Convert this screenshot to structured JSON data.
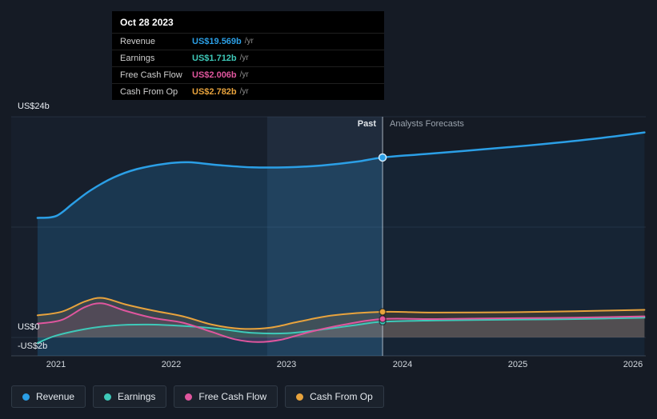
{
  "tooltip": {
    "date": "Oct 28 2023",
    "rows": [
      {
        "label": "Revenue",
        "value": "US$19.569b",
        "suffix": "/yr",
        "color": "#2b9fe6"
      },
      {
        "label": "Earnings",
        "value": "US$1.712b",
        "suffix": "/yr",
        "color": "#3ec9b9"
      },
      {
        "label": "Free Cash Flow",
        "value": "US$2.006b",
        "suffix": "/yr",
        "color": "#e0569e"
      },
      {
        "label": "Cash From Op",
        "value": "US$2.782b",
        "suffix": "/yr",
        "color": "#e8a33d"
      }
    ]
  },
  "annotations": {
    "past": "Past",
    "forecast": "Analysts Forecasts"
  },
  "axis": {
    "y_labels": [
      "US$24b",
      "US$0",
      "-US$2b"
    ],
    "x_labels": [
      "2021",
      "2022",
      "2023",
      "2024",
      "2025",
      "2026"
    ]
  },
  "legend": [
    {
      "label": "Revenue",
      "color": "#2b9fe6"
    },
    {
      "label": "Earnings",
      "color": "#3ec9b9"
    },
    {
      "label": "Free Cash Flow",
      "color": "#e0569e"
    },
    {
      "label": "Cash From Op",
      "color": "#e8a33d"
    }
  ],
  "chart_data": {
    "type": "area",
    "x_unit": "year",
    "xlim": [
      2020.6,
      2026.11
    ],
    "ylim": [
      -2,
      24
    ],
    "y_gridlines": [
      24,
      12,
      0
    ],
    "x_ticks": [
      2021,
      2022,
      2023,
      2024,
      2025,
      2026
    ],
    "divider_x": 2023.83,
    "hover_band": [
      2022.83,
      2023.83
    ],
    "legend_position": "bottom",
    "series": [
      {
        "name": "Revenue",
        "color": "#2b9fe6",
        "points": [
          [
            2020.84,
            13.0
          ],
          [
            2021.0,
            13.2
          ],
          [
            2021.15,
            14.6
          ],
          [
            2021.3,
            16.0
          ],
          [
            2021.5,
            17.4
          ],
          [
            2021.7,
            18.3
          ],
          [
            2021.95,
            18.9
          ],
          [
            2022.15,
            19.05
          ],
          [
            2022.4,
            18.75
          ],
          [
            2022.7,
            18.5
          ],
          [
            2023.0,
            18.5
          ],
          [
            2023.3,
            18.7
          ],
          [
            2023.6,
            19.1
          ],
          [
            2023.83,
            19.569
          ],
          [
            2024.2,
            19.95
          ],
          [
            2024.7,
            20.45
          ],
          [
            2025.2,
            21.0
          ],
          [
            2025.7,
            21.65
          ],
          [
            2026.1,
            22.3
          ]
        ]
      },
      {
        "name": "Earnings",
        "color": "#3ec9b9",
        "points": [
          [
            2020.84,
            -0.6
          ],
          [
            2021.0,
            0.2
          ],
          [
            2021.25,
            0.9
          ],
          [
            2021.5,
            1.3
          ],
          [
            2021.8,
            1.4
          ],
          [
            2022.1,
            1.25
          ],
          [
            2022.4,
            0.95
          ],
          [
            2022.7,
            0.5
          ],
          [
            2023.0,
            0.45
          ],
          [
            2023.3,
            0.85
          ],
          [
            2023.6,
            1.35
          ],
          [
            2023.83,
            1.712
          ],
          [
            2024.3,
            1.85
          ],
          [
            2025.0,
            1.95
          ],
          [
            2025.5,
            2.0
          ],
          [
            2026.1,
            2.15
          ]
        ]
      },
      {
        "name": "Free Cash Flow",
        "color": "#e0569e",
        "points": [
          [
            2020.84,
            1.5
          ],
          [
            2021.05,
            1.9
          ],
          [
            2021.25,
            3.3
          ],
          [
            2021.4,
            3.7
          ],
          [
            2021.6,
            2.9
          ],
          [
            2021.85,
            2.1
          ],
          [
            2022.1,
            1.6
          ],
          [
            2022.35,
            0.6
          ],
          [
            2022.55,
            -0.2
          ],
          [
            2022.75,
            -0.5
          ],
          [
            2022.95,
            -0.25
          ],
          [
            2023.2,
            0.6
          ],
          [
            2023.5,
            1.4
          ],
          [
            2023.83,
            2.006
          ],
          [
            2024.3,
            2.0
          ],
          [
            2025.0,
            2.1
          ],
          [
            2025.5,
            2.15
          ],
          [
            2026.1,
            2.3
          ]
        ]
      },
      {
        "name": "Cash From Op",
        "color": "#e8a33d",
        "points": [
          [
            2020.84,
            2.4
          ],
          [
            2021.05,
            2.8
          ],
          [
            2021.25,
            3.9
          ],
          [
            2021.4,
            4.3
          ],
          [
            2021.6,
            3.6
          ],
          [
            2021.85,
            2.9
          ],
          [
            2022.1,
            2.3
          ],
          [
            2022.35,
            1.4
          ],
          [
            2022.6,
            0.95
          ],
          [
            2022.85,
            1.05
          ],
          [
            2023.1,
            1.7
          ],
          [
            2023.4,
            2.4
          ],
          [
            2023.83,
            2.782
          ],
          [
            2024.3,
            2.7
          ],
          [
            2025.0,
            2.75
          ],
          [
            2025.5,
            2.85
          ],
          [
            2026.1,
            3.0
          ]
        ]
      }
    ],
    "markers": [
      {
        "series": "Earnings",
        "x": 2023.83,
        "y": 1.712
      },
      {
        "series": "Free Cash Flow",
        "x": 2023.83,
        "y": 2.006
      },
      {
        "series": "Cash From Op",
        "x": 2023.83,
        "y": 2.782
      },
      {
        "series": "Revenue",
        "x": 2023.83,
        "y": 19.569
      }
    ]
  }
}
